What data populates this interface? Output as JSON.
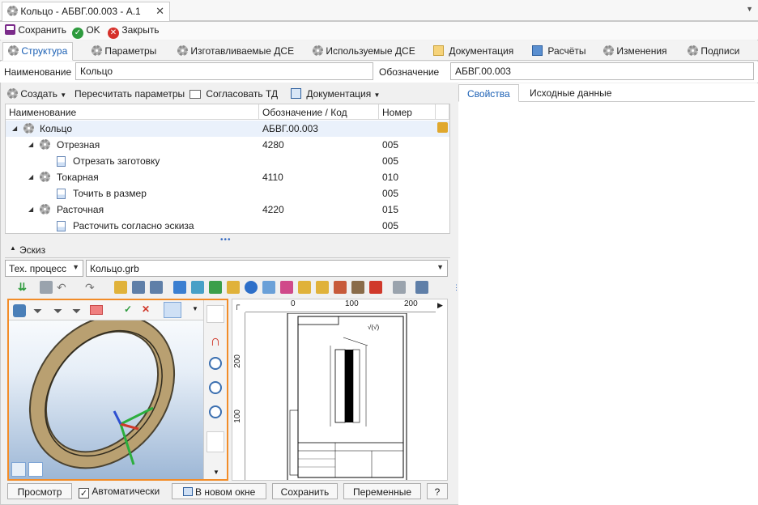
{
  "window": {
    "doc_tab_title": "Кольцо - АБВГ.00.003 - А.1",
    "doc_tab_icon": "gear-icon",
    "close_glyph": "✕",
    "tab_menu_glyph": "▼"
  },
  "actions": {
    "save": "Сохранить",
    "ok": "OK",
    "close": "Закрыть"
  },
  "main_tabs": [
    {
      "label": "Структура",
      "icon": "gear-icon"
    },
    {
      "label": "Параметры",
      "icon": "gear-icon"
    },
    {
      "label": "Изготавливаемые ДСЕ",
      "icon": "gear-icon"
    },
    {
      "label": "Используемые ДСЕ",
      "icon": "gear-icon"
    },
    {
      "label": "Документация",
      "icon": "document-icon"
    },
    {
      "label": "Расчёты",
      "icon": "calculator-icon"
    },
    {
      "label": "Изменения",
      "icon": "gear-icon"
    },
    {
      "label": "Подписи",
      "icon": "gear-icon"
    }
  ],
  "name_row": {
    "name_label": "Наименование",
    "name_value": "Кольцо",
    "designation_label": "Обозначение",
    "designation_value": "АБВГ.00.003"
  },
  "tree_toolbar": {
    "create": "Создать",
    "recalc": "Пересчитать параметры",
    "approve": "Согласовать ТД",
    "docs": "Документация"
  },
  "tree": {
    "columns": [
      "Наименование",
      "Обозначение / Код",
      "Номер"
    ],
    "rows": [
      {
        "name": "Кольцо",
        "code": "АБВГ.00.003",
        "number": ""
      },
      {
        "name": "Отрезная",
        "code": "4280",
        "number": "005"
      },
      {
        "name": "Отрезать заготовку",
        "code": "",
        "number": "005"
      },
      {
        "name": "Токарная",
        "code": "4110",
        "number": "010"
      },
      {
        "name": "Точить в размер",
        "code": "",
        "number": "005"
      },
      {
        "name": "Расточная",
        "code": "4220",
        "number": "015"
      },
      {
        "name": "Расточить согласно эскиза",
        "code": "",
        "number": "005"
      }
    ]
  },
  "sketch": {
    "header": "Эскиз",
    "process_select": "Тех. процесс",
    "file_select": "Кольцо.grb"
  },
  "drawing": {
    "ruler_top": [
      "0",
      "100",
      "200"
    ],
    "ruler_left": [
      "200",
      "100"
    ]
  },
  "bottom_buttons": {
    "preview": "Просмотр",
    "auto": "Автоматически",
    "new_window": "В новом окне",
    "save": "Сохранить",
    "variables": "Переменные",
    "help": "?"
  },
  "right_tabs": [
    "Свойства",
    "Исходные данные"
  ],
  "colors": {
    "accent": "#1a5fb4",
    "highlight_border": "#f28c28",
    "ring": "#b9a071"
  }
}
